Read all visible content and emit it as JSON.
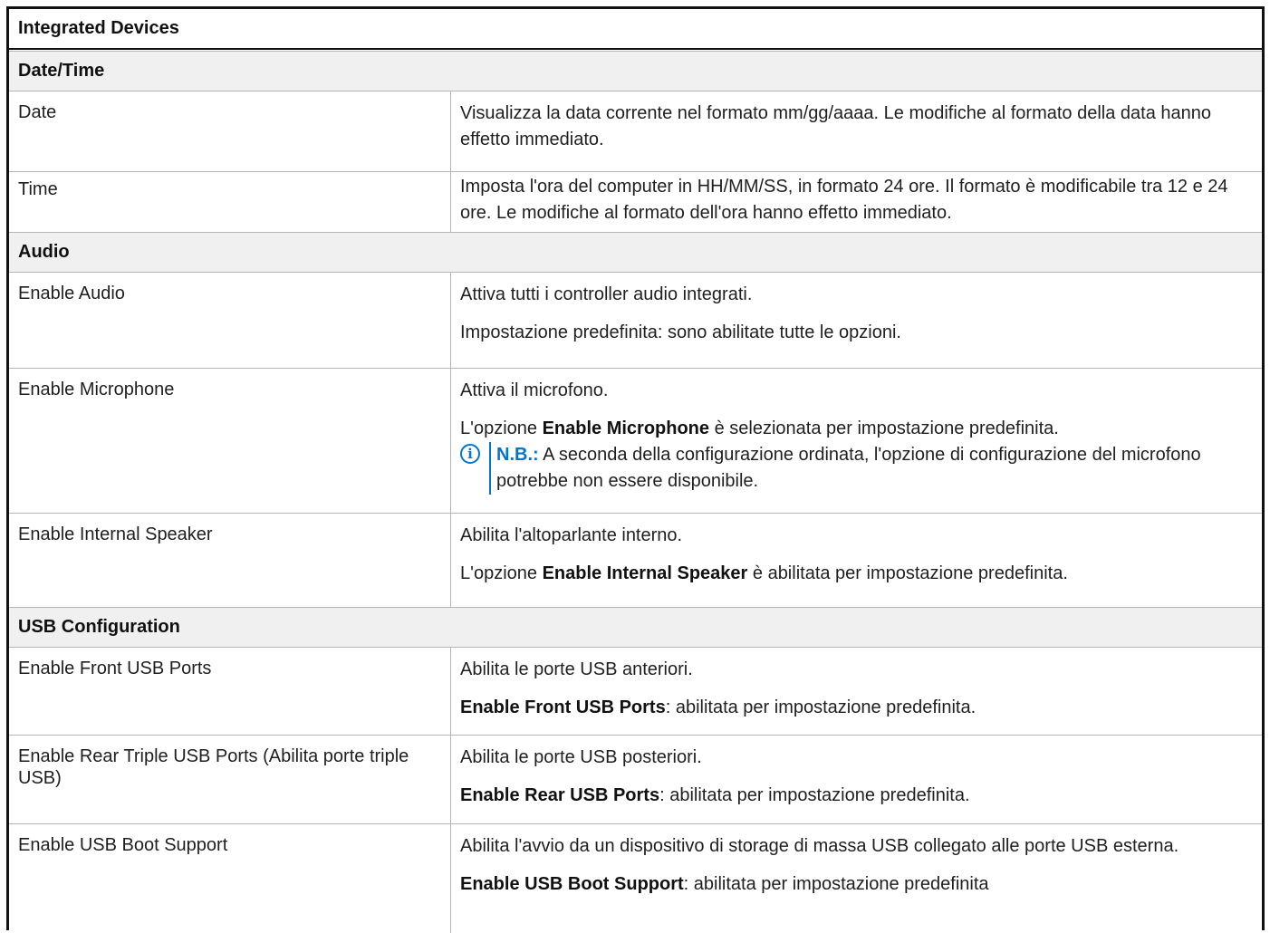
{
  "title": "Integrated Devices",
  "sections": {
    "datetime": {
      "header": "Date/Time",
      "date": {
        "label": "Date",
        "desc": "Visualizza la data corrente nel formato mm/gg/aaaa. Le modifiche al formato della data hanno effetto immediato."
      },
      "time": {
        "label": "Time",
        "desc": "Imposta l'ora del computer in HH/MM/SS, in formato 24 ore. Il formato è modificabile tra 12 e 24 ore. Le modifiche al formato dell'ora hanno effetto immediato."
      }
    },
    "audio": {
      "header": "Audio",
      "enable_audio": {
        "label": "Enable Audio",
        "desc": "Attiva tutti i controller audio integrati.",
        "default": "Impostazione predefinita: sono abilitate tutte le opzioni."
      },
      "enable_microphone": {
        "label": "Enable Microphone",
        "desc": "Attiva il microfono.",
        "default_prefix": "L'opzione ",
        "default_bold": "Enable Microphone",
        "default_suffix": " è selezionata per impostazione predefinita.",
        "note_icon": "info-icon",
        "note_label": "N.B.:",
        "note_text": " A seconda della configurazione ordinata, l'opzione di configurazione del microfono potrebbe non essere disponibile."
      },
      "enable_internal_speaker": {
        "label": "Enable Internal Speaker",
        "desc": "Abilita l'altoparlante interno.",
        "default_prefix": "L'opzione ",
        "default_bold": "Enable Internal Speaker",
        "default_suffix": " è abilitata per impostazione predefinita."
      }
    },
    "usb": {
      "header": "USB Configuration",
      "front_ports": {
        "label": "Enable Front USB Ports",
        "desc": "Abilita le porte USB anteriori.",
        "default_bold": "Enable Front USB Ports",
        "default_suffix": ": abilitata per impostazione predefinita."
      },
      "rear_ports": {
        "label": "Enable Rear Triple USB Ports (Abilita porte triple USB)",
        "desc": "Abilita le porte USB posteriori.",
        "default_bold": "Enable Rear USB Ports",
        "default_suffix": ": abilitata per impostazione predefinita."
      },
      "boot_support": {
        "label": "Enable USB Boot Support",
        "desc": "Abilita l'avvio da un dispositivo di storage di massa USB collegato alle porte USB esterna.",
        "default_bold": "Enable USB Boot Support",
        "default_suffix": ": abilitata per impostazione predefinita"
      }
    }
  },
  "colors": {
    "note_accent": "#0076ce",
    "section_bg": "#f0f0f0",
    "border": "#b5b5b5"
  }
}
